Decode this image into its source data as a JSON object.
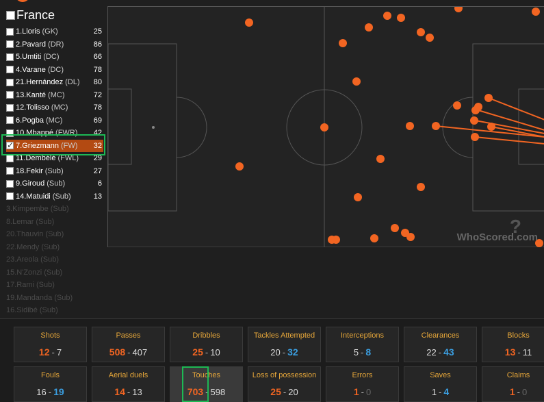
{
  "team": {
    "name": "France"
  },
  "players": [
    {
      "name": "1.Lloris",
      "pos": "(GK)",
      "rating": "25",
      "checked": false,
      "dim": false
    },
    {
      "name": "2.Pavard",
      "pos": "(DR)",
      "rating": "86",
      "checked": false,
      "dim": false
    },
    {
      "name": "5.Umtiti",
      "pos": "(DC)",
      "rating": "66",
      "checked": false,
      "dim": false
    },
    {
      "name": "4.Varane",
      "pos": "(DC)",
      "rating": "78",
      "checked": false,
      "dim": false
    },
    {
      "name": "21.Hernández",
      "pos": "(DL)",
      "rating": "80",
      "checked": false,
      "dim": false
    },
    {
      "name": "13.Kanté",
      "pos": "(MC)",
      "rating": "72",
      "checked": false,
      "dim": false
    },
    {
      "name": "12.Tolisso",
      "pos": "(MC)",
      "rating": "78",
      "checked": false,
      "dim": false
    },
    {
      "name": "6.Pogba",
      "pos": "(MC)",
      "rating": "69",
      "checked": false,
      "dim": false
    },
    {
      "name": "10.Mbappé",
      "pos": "(FWR)",
      "rating": "42",
      "checked": false,
      "dim": false
    },
    {
      "name": "7.Griezmann",
      "pos": "(FW)",
      "rating": "32",
      "checked": true,
      "dim": false
    },
    {
      "name": "11.Dembélé",
      "pos": "(FWL)",
      "rating": "29",
      "checked": false,
      "dim": false
    },
    {
      "name": "18.Fekir",
      "pos": "(Sub)",
      "rating": "27",
      "checked": false,
      "dim": false
    },
    {
      "name": "9.Giroud",
      "pos": "(Sub)",
      "rating": "6",
      "checked": false,
      "dim": false
    },
    {
      "name": "14.Matuidi",
      "pos": "(Sub)",
      "rating": "13",
      "checked": false,
      "dim": false
    },
    {
      "name": "3.Kimpembe",
      "pos": "(Sub)",
      "rating": "",
      "checked": false,
      "dim": true
    },
    {
      "name": "8.Lemar",
      "pos": "(Sub)",
      "rating": "",
      "checked": false,
      "dim": true
    },
    {
      "name": "20.Thauvin",
      "pos": "(Sub)",
      "rating": "",
      "checked": false,
      "dim": true
    },
    {
      "name": "22.Mendy",
      "pos": "(Sub)",
      "rating": "",
      "checked": false,
      "dim": true
    },
    {
      "name": "23.Areola",
      "pos": "(Sub)",
      "rating": "",
      "checked": false,
      "dim": true
    },
    {
      "name": "15.N'Zonzi",
      "pos": "(Sub)",
      "rating": "",
      "checked": false,
      "dim": true
    },
    {
      "name": "17.Rami",
      "pos": "(Sub)",
      "rating": "",
      "checked": false,
      "dim": true
    },
    {
      "name": "19.Mandanda",
      "pos": "(Sub)",
      "rating": "",
      "checked": false,
      "dim": true
    },
    {
      "name": "16.Sidibé",
      "pos": "(Sub)",
      "rating": "",
      "checked": false,
      "dim": true
    }
  ],
  "watermark": "WhoScored.com",
  "colors": {
    "home": "#f26522",
    "away": "#3b9ee0",
    "title": "#e8a83a",
    "highlight": "#1db954"
  },
  "stats_row1": [
    {
      "title": "Shots",
      "home": "12",
      "away": "7",
      "leader": "home"
    },
    {
      "title": "Passes",
      "home": "508",
      "away": "407",
      "leader": "home"
    },
    {
      "title": "Dribbles",
      "home": "25",
      "away": "10",
      "leader": "home"
    },
    {
      "title": "Tackles Attempted",
      "home": "20",
      "away": "32",
      "leader": "away"
    },
    {
      "title": "Interceptions",
      "home": "5",
      "away": "8",
      "leader": "away"
    },
    {
      "title": "Clearances",
      "home": "22",
      "away": "43",
      "leader": "away"
    },
    {
      "title": "Blocks",
      "home": "13",
      "away": "11",
      "leader": "home"
    }
  ],
  "stats_row2": [
    {
      "title": "Fouls",
      "home": "16",
      "away": "19",
      "leader": "away"
    },
    {
      "title": "Aerial duels",
      "home": "14",
      "away": "13",
      "leader": "home"
    },
    {
      "title": "Touches",
      "home": "703",
      "away": "598",
      "leader": "home"
    },
    {
      "title": "Loss of possession",
      "home": "25",
      "away": "20",
      "leader": "home"
    },
    {
      "title": "Errors",
      "home": "1",
      "away": "0",
      "leader": "home"
    },
    {
      "title": "Saves",
      "home": "1",
      "away": "4",
      "leader": "away"
    },
    {
      "title": "Claims",
      "home": "1",
      "away": "0",
      "leader": "home"
    }
  ]
}
